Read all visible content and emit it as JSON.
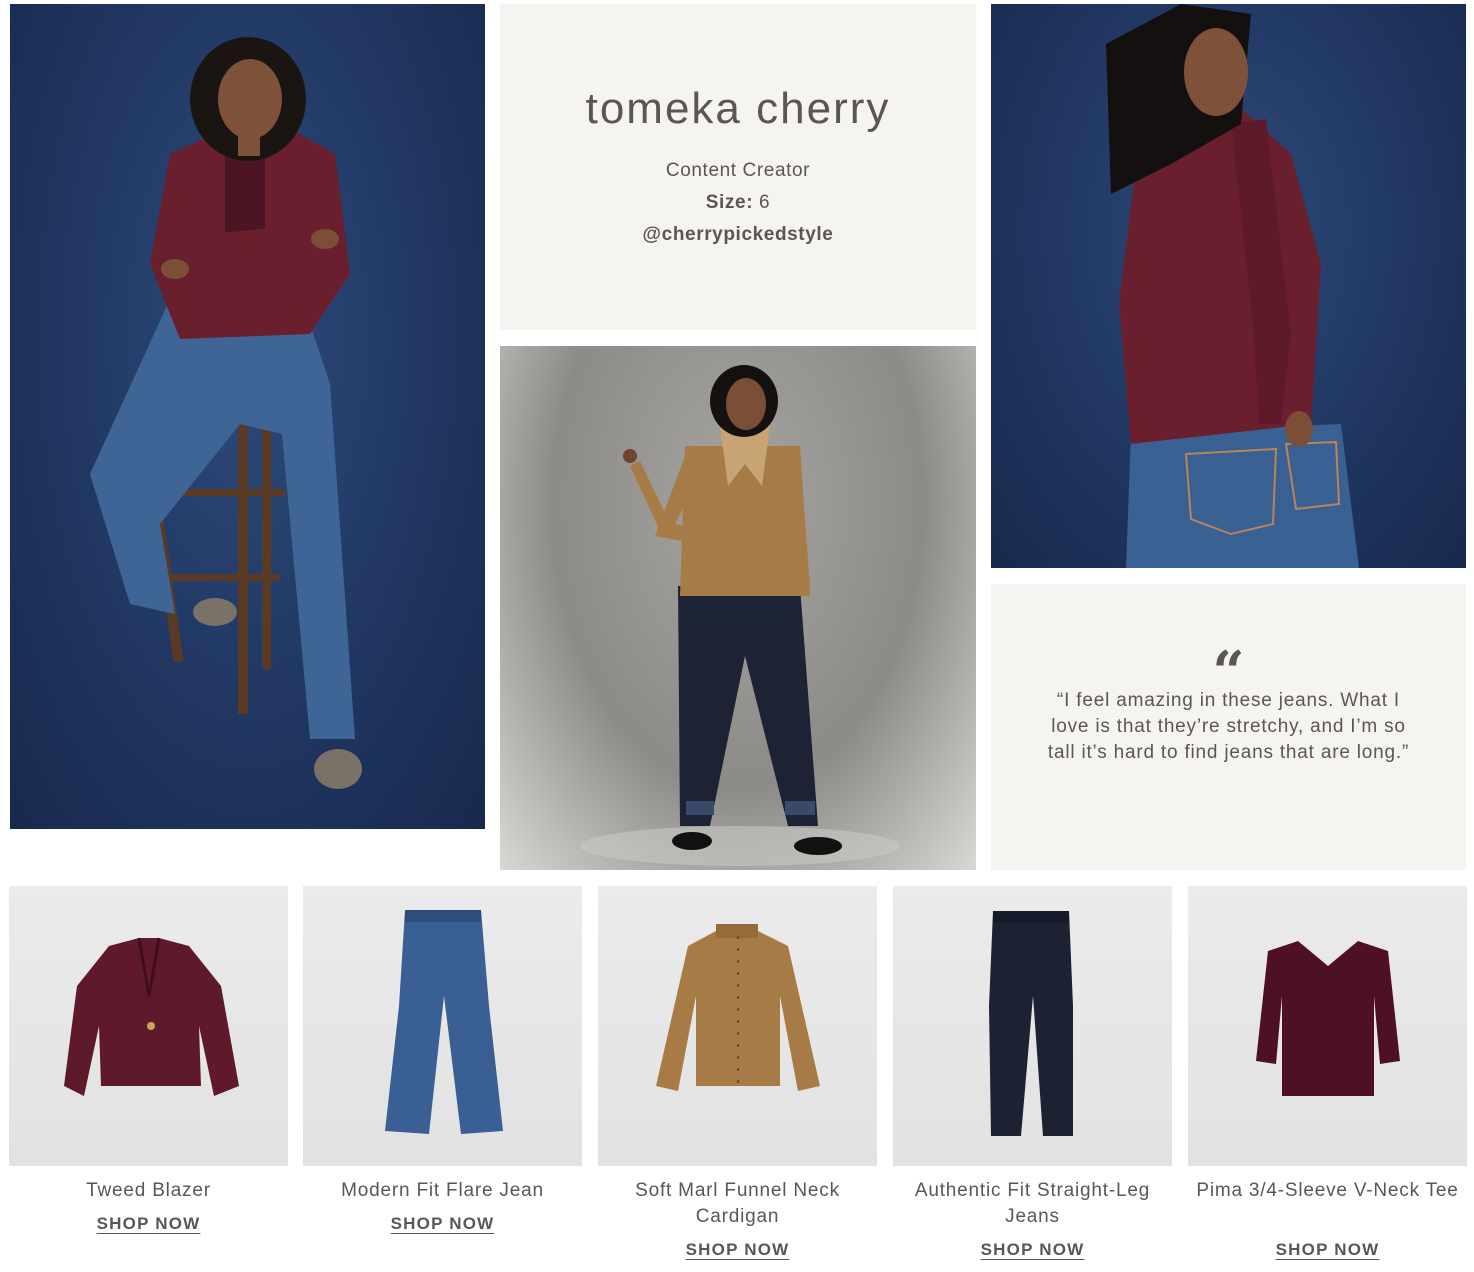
{
  "profile": {
    "name": "tomeka cherry",
    "role": "Content Creator",
    "size_label": "Size:",
    "size_value": "6",
    "handle": "@cherrypickedstyle"
  },
  "quote": {
    "mark": "“",
    "text": "“I feel amazing in these jeans. What I love is that they’re stretchy, and I’m so tall it’s hard to find jeans that are long.”"
  },
  "products": [
    {
      "name": "Tweed Blazer",
      "cta": "SHOP NOW",
      "icon": "blazer-icon",
      "color": "#5e1a2b"
    },
    {
      "name": "Modern Fit Flare Jean",
      "cta": "SHOP NOW",
      "icon": "flare-jean-icon",
      "color": "#3a5f95"
    },
    {
      "name": "Soft Marl Funnel Neck Cardigan",
      "cta": "SHOP NOW",
      "icon": "cardigan-icon",
      "color": "#a67b45"
    },
    {
      "name": "Authentic Fit Straight-Leg Jeans",
      "cta": "SHOP NOW",
      "icon": "straight-jean-icon",
      "color": "#1d2233"
    },
    {
      "name": "Pima 3/4-Sleeve V-Neck Tee",
      "cta": "SHOP NOW",
      "icon": "vneck-tee-icon",
      "color": "#4e1026"
    }
  ],
  "colors": {
    "cream": "#f6f4f0",
    "text": "#5a5653",
    "burgundy": "#6a1f2e",
    "denim": "#3b5d8f",
    "navy_backdrop": "#223a66"
  }
}
